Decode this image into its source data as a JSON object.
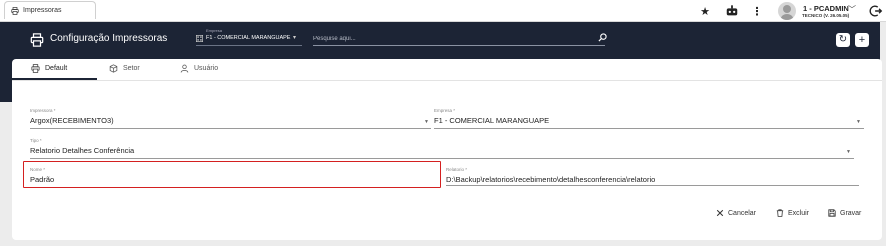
{
  "browser": {
    "tab_title": "Impressoras",
    "user_name": "1 - PCADMIN",
    "user_subtitle": "TECNICO (V. 26.05.05)",
    "icons": [
      "star-icon",
      "robot-icon",
      "more-vert-icon",
      "chevron-down-icon",
      "logout-icon"
    ]
  },
  "header": {
    "title": "Configuração Impressoras",
    "empresa_label": "Empresa",
    "empresa_value": "F1 - COMERCIAL MARANGUAPE",
    "search_placeholder": "Pesquise aqui...",
    "refresh_symbol": "↻",
    "add_symbol": "+"
  },
  "tabs": [
    {
      "label": "Default",
      "active": true
    },
    {
      "label": "Setor",
      "active": false
    },
    {
      "label": "Usuário",
      "active": false
    }
  ],
  "form": {
    "impressora": {
      "label": "Impressora *",
      "value": "Argox(RECEBIMENTO3)"
    },
    "empresa": {
      "label": "Empresa *",
      "value": "F1 - COMERCIAL MARANGUAPE"
    },
    "tipo": {
      "label": "Tipo *",
      "value": "Relatorio Detalhes Conferência"
    },
    "nome": {
      "label": "Nome *",
      "value": "Padrão"
    },
    "relatorio": {
      "label": "Relatorio *",
      "value": "D:\\Backup\\relatorios\\recebimento\\detalhesconferencia\\relatorio"
    }
  },
  "actions": {
    "cancel": "Cancelar",
    "delete": "Excluir",
    "save": "Gravar"
  },
  "colors": {
    "header_bg": "#1c2435",
    "highlight_border": "#d42020",
    "page_bg": "#ececec"
  }
}
